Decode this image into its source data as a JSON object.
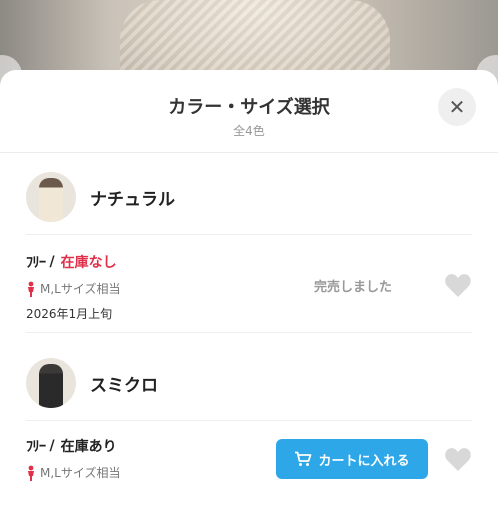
{
  "sheet": {
    "title": "カラー・サイズ選択",
    "subtitle": "全4色"
  },
  "colors": [
    {
      "name": "ナチュラル",
      "variants": [
        {
          "size": "ﾌﾘｰ",
          "separator": "/",
          "stock": "在庫なし",
          "fit": "M,Lサイズ相当",
          "arrival": "2026年1月上旬",
          "status": "完売しました"
        }
      ]
    },
    {
      "name": "スミクロ",
      "variants": [
        {
          "size": "ﾌﾘｰ",
          "separator": "/",
          "stock": "在庫あり",
          "fit": "M,Lサイズ相当",
          "action": "カートに入れる"
        }
      ]
    }
  ],
  "icons": {
    "close": "close-icon",
    "heart": "heart-icon",
    "cart": "cart-icon",
    "person": "person-icon"
  },
  "colors_ui": {
    "accent": "#2ea7e8",
    "out_of_stock": "#e0304a",
    "heart_gray": "#d8d8d8"
  }
}
